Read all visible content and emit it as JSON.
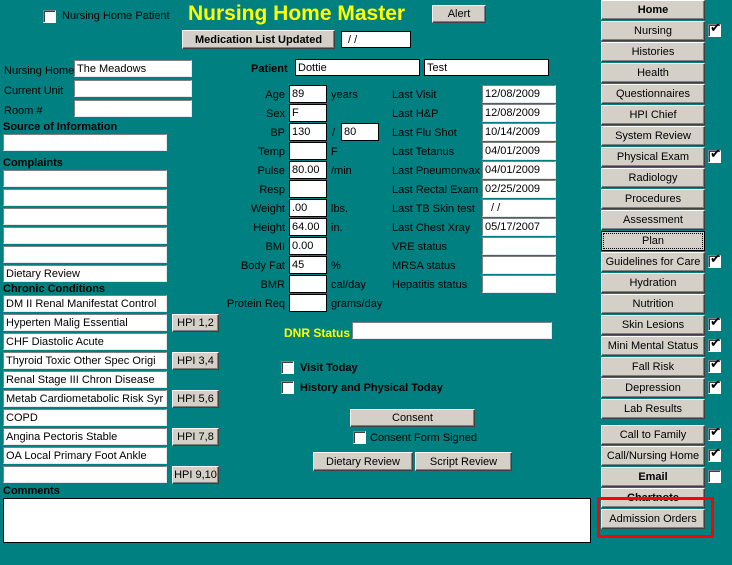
{
  "app": {
    "title": "Nursing Home Master",
    "background_color": "#008080",
    "title_color": "#ffff00",
    "button_face_color": "#d4d0c8",
    "highlight_color": "#ff0000"
  },
  "header": {
    "nursing_home_patient_label": "Nursing Home Patient",
    "nursing_home_patient_checked": false,
    "alert_button": "Alert",
    "medication_list_button": "Medication List Updated",
    "medication_list_date": "/  /"
  },
  "facility": {
    "nursing_home_label": "Nursing Home",
    "nursing_home_value": "The Meadows",
    "current_unit_label": "Current Unit",
    "current_unit_value": "",
    "room_label": "Room #",
    "room_value": ""
  },
  "source": {
    "heading": "Source of Information",
    "value": ""
  },
  "complaints": {
    "heading": "Complaints",
    "rows": [
      "",
      "",
      "",
      "",
      "",
      "Dietary Review"
    ]
  },
  "chronic": {
    "heading": "Chronic Conditions",
    "rows": [
      "DM  II Renal Manifestat Control",
      "Hyperten Malig Essential",
      "CHF Diastolic Acute",
      "Thyroid Toxic Other Spec Origi",
      "Renal  Stage III Chron Disease",
      "Metab Cardiometabolic Risk Syr",
      "COPD",
      "Angina Pectoris Stable",
      "OA Local Primary Foot Ankle",
      ""
    ],
    "hpi_buttons": [
      "HPI 1,2",
      "HPI 3,4",
      "HPI 5,6",
      "HPI 7,8",
      "HPI 9,10"
    ]
  },
  "patient": {
    "label": "Patient",
    "first_name": "Dottie",
    "last_name": "Test"
  },
  "vitals": [
    {
      "label": "Age",
      "value": "89",
      "unit": "years"
    },
    {
      "label": "Sex",
      "value": "F",
      "unit": ""
    },
    {
      "label": "BP",
      "value": "130",
      "unit": "",
      "value2": "80",
      "separator": "/"
    },
    {
      "label": "Temp",
      "value": "",
      "unit": "F"
    },
    {
      "label": "Pulse",
      "value": "80.00",
      "unit": "/min"
    },
    {
      "label": "Resp",
      "value": "",
      "unit": ""
    },
    {
      "label": "Weight",
      "value": ".00",
      "unit": "lbs."
    },
    {
      "label": "Height",
      "value": "64.00",
      "unit": "in."
    },
    {
      "label": "BMI",
      "value": "0.00",
      "unit": ""
    },
    {
      "label": "Body Fat",
      "value": "45",
      "unit": "%"
    },
    {
      "label": "BMR",
      "value": "",
      "unit": "cal/day"
    },
    {
      "label": "Protein Req",
      "value": "",
      "unit": "grams/day"
    }
  ],
  "history": [
    {
      "label": "Last Visit",
      "value": "12/08/2009"
    },
    {
      "label": "Last H&P",
      "value": "12/08/2009"
    },
    {
      "label": "Last Flu Shot",
      "value": "10/14/2009"
    },
    {
      "label": "Last Tetanus",
      "value": "04/01/2009"
    },
    {
      "label": "Last Pneumonvax",
      "value": "04/01/2009"
    },
    {
      "label": "Last Rectal Exam",
      "value": "02/25/2009"
    },
    {
      "label": "Last TB Skin test",
      "value": "/  /"
    },
    {
      "label": "Last Chest Xray",
      "value": "05/17/2007"
    },
    {
      "label": "VRE status",
      "value": ""
    },
    {
      "label": "MRSA status",
      "value": ""
    },
    {
      "label": "Hepatitis status",
      "value": ""
    }
  ],
  "dnr": {
    "label": "DNR Status",
    "value": ""
  },
  "visit_flags": [
    {
      "label": "Visit Today",
      "checked": false
    },
    {
      "label": "History and Physical Today",
      "checked": false
    }
  ],
  "consent": {
    "button": "Consent",
    "signed_label": "Consent Form Signed",
    "signed_checked": false
  },
  "review_buttons": {
    "dietary": "Dietary Review",
    "script": "Script Review"
  },
  "comments": {
    "heading": "Comments",
    "value": ""
  },
  "sidebar": {
    "items": [
      {
        "label": "Home",
        "bold": true,
        "checkbox": false,
        "checked": false,
        "focused": false
      },
      {
        "label": "Nursing",
        "bold": false,
        "checkbox": true,
        "checked": true,
        "focused": false
      },
      {
        "label": "Histories",
        "bold": false,
        "checkbox": false,
        "checked": false,
        "focused": false
      },
      {
        "label": "Health",
        "bold": false,
        "checkbox": false,
        "checked": false,
        "focused": false
      },
      {
        "label": "Questionnaires",
        "bold": false,
        "checkbox": false,
        "checked": false,
        "focused": false
      },
      {
        "label": "HPI Chief",
        "bold": false,
        "checkbox": false,
        "checked": false,
        "focused": false
      },
      {
        "label": "System Review",
        "bold": false,
        "checkbox": false,
        "checked": false,
        "focused": false
      },
      {
        "label": "Physical Exam",
        "bold": false,
        "checkbox": true,
        "checked": true,
        "focused": false
      },
      {
        "label": "Radiology",
        "bold": false,
        "checkbox": false,
        "checked": false,
        "focused": false
      },
      {
        "label": "Procedures",
        "bold": false,
        "checkbox": false,
        "checked": false,
        "focused": false
      },
      {
        "label": "Assessment",
        "bold": false,
        "checkbox": false,
        "checked": false,
        "focused": false
      },
      {
        "label": "Plan",
        "bold": false,
        "checkbox": false,
        "checked": false,
        "focused": true
      },
      {
        "label": "Guidelines for Care",
        "bold": false,
        "checkbox": true,
        "checked": true,
        "focused": false
      },
      {
        "label": "Hydration",
        "bold": false,
        "checkbox": false,
        "checked": false,
        "focused": false
      },
      {
        "label": "Nutrition",
        "bold": false,
        "checkbox": false,
        "checked": false,
        "focused": false
      },
      {
        "label": "Skin Lesions",
        "bold": false,
        "checkbox": true,
        "checked": true,
        "focused": false
      },
      {
        "label": "Mini Mental Status",
        "bold": false,
        "checkbox": true,
        "checked": true,
        "focused": false
      },
      {
        "label": "Fall Risk",
        "bold": false,
        "checkbox": true,
        "checked": true,
        "focused": false
      },
      {
        "label": "Depression",
        "bold": false,
        "checkbox": true,
        "checked": true,
        "focused": false
      },
      {
        "label": "Lab Results",
        "bold": false,
        "checkbox": false,
        "checked": false,
        "focused": false
      },
      {
        "label": "Call to Family",
        "bold": false,
        "checkbox": true,
        "checked": true,
        "focused": false
      },
      {
        "label": "Call/Nursing Home",
        "bold": false,
        "checkbox": true,
        "checked": true,
        "focused": false
      },
      {
        "label": "Email",
        "bold": true,
        "checkbox": true,
        "checked": false,
        "focused": false
      },
      {
        "label": "Chartnote",
        "bold": true,
        "checkbox": false,
        "checked": false,
        "focused": false
      },
      {
        "label": "Admission Orders",
        "bold": false,
        "checkbox": false,
        "checked": false,
        "focused": false
      }
    ],
    "highlighted_item": "Chartnote"
  }
}
